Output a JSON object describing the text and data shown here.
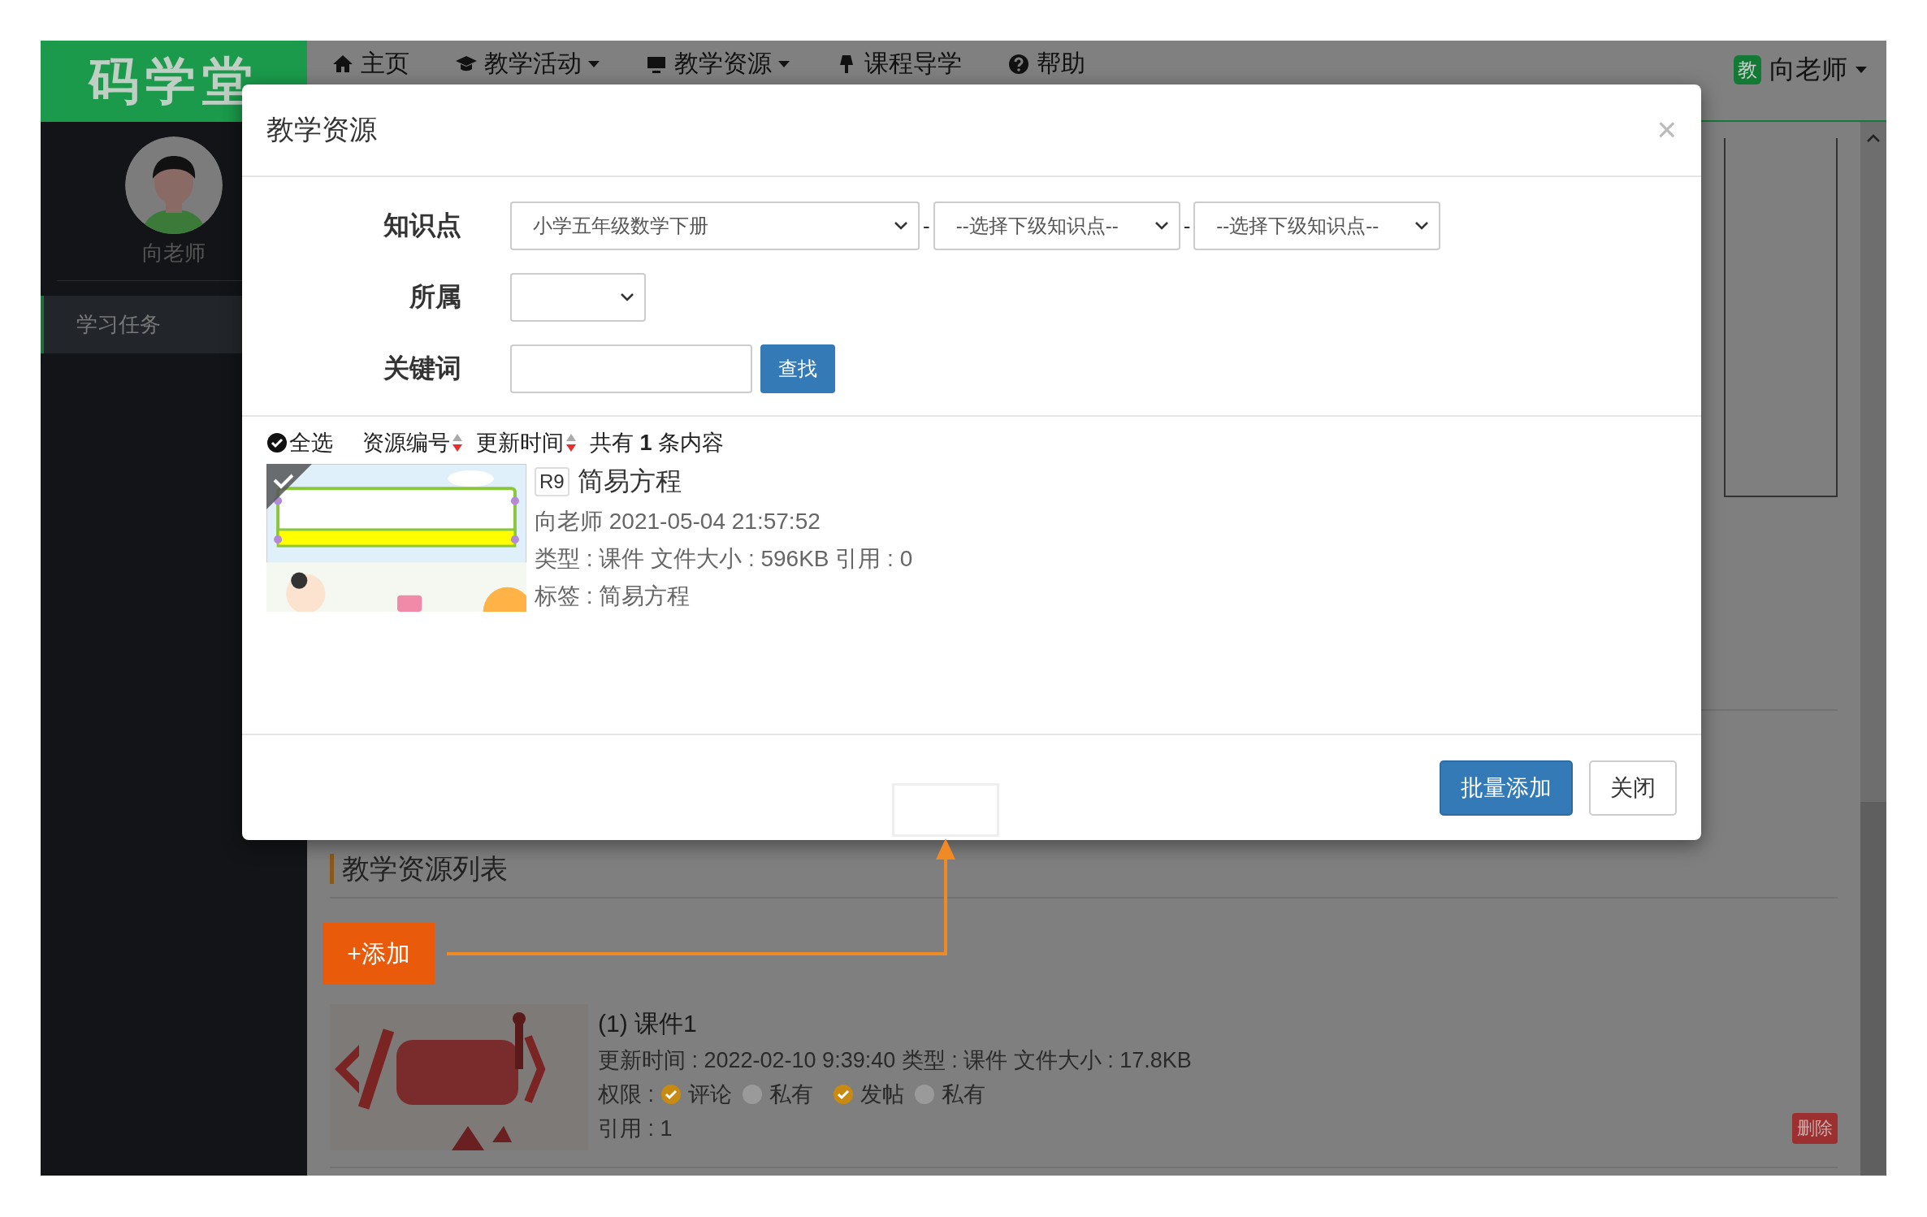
{
  "nav": {
    "logo": "码学堂",
    "items": [
      {
        "label": "主页",
        "kind": "link"
      },
      {
        "label": "教学活动",
        "kind": "dropdown"
      },
      {
        "label": "教学资源",
        "kind": "dropdown"
      },
      {
        "label": "课程导学",
        "kind": "link"
      },
      {
        "label": "帮助",
        "kind": "link"
      }
    ],
    "user": {
      "badge": "教",
      "name": "向老师"
    }
  },
  "sidebar": {
    "user_name": "向老师",
    "items": [
      {
        "label": "学习任务",
        "selected": true
      }
    ]
  },
  "page": {
    "section_title": "教学资源列表",
    "add_button": "+添加",
    "resources": [
      {
        "title": "(1) 课件1",
        "meta": "更新时间 : 2022-02-10 9:39:40 类型 : 课件 文件大小 : 17.8KB",
        "permissions_label": "权限 :",
        "permissions": [
          {
            "label": "评论",
            "checked": true
          },
          {
            "label": "私有",
            "checked": false
          },
          {
            "label": "发帖",
            "checked": true
          },
          {
            "label": "私有",
            "checked": false
          }
        ],
        "references": "引用 : 1",
        "delete_button": "删除"
      }
    ]
  },
  "modal": {
    "title": "教学资源",
    "close": "×",
    "filters": [
      {
        "label": "知识点",
        "kind": "selects",
        "selects": [
          "小学五年级数学下册",
          "--选择下级知识点--",
          "--选择下级知识点--"
        ],
        "separator": "-"
      },
      {
        "label": "所属",
        "kind": "select"
      },
      {
        "label": "关键词",
        "kind": "search",
        "button": "查找"
      }
    ],
    "toolbar": {
      "select_all": {
        "label": "全选",
        "checked": true
      },
      "sorts": [
        "资源编号",
        "更新时间"
      ],
      "count": "共有 **1** 条内容"
    },
    "items": [
      {
        "code": "R9",
        "title": "简易方程",
        "author_time": "向老师 2021-05-04 21:57:52",
        "details": "类型 : 课件 文件大小 : 596KB 引用 : 0",
        "tags": "标签 : 简易方程",
        "selected": true
      }
    ],
    "buttons": [
      {
        "label": "批量添加",
        "kind": "primary"
      },
      {
        "label": "关闭",
        "kind": "default"
      }
    ]
  }
}
